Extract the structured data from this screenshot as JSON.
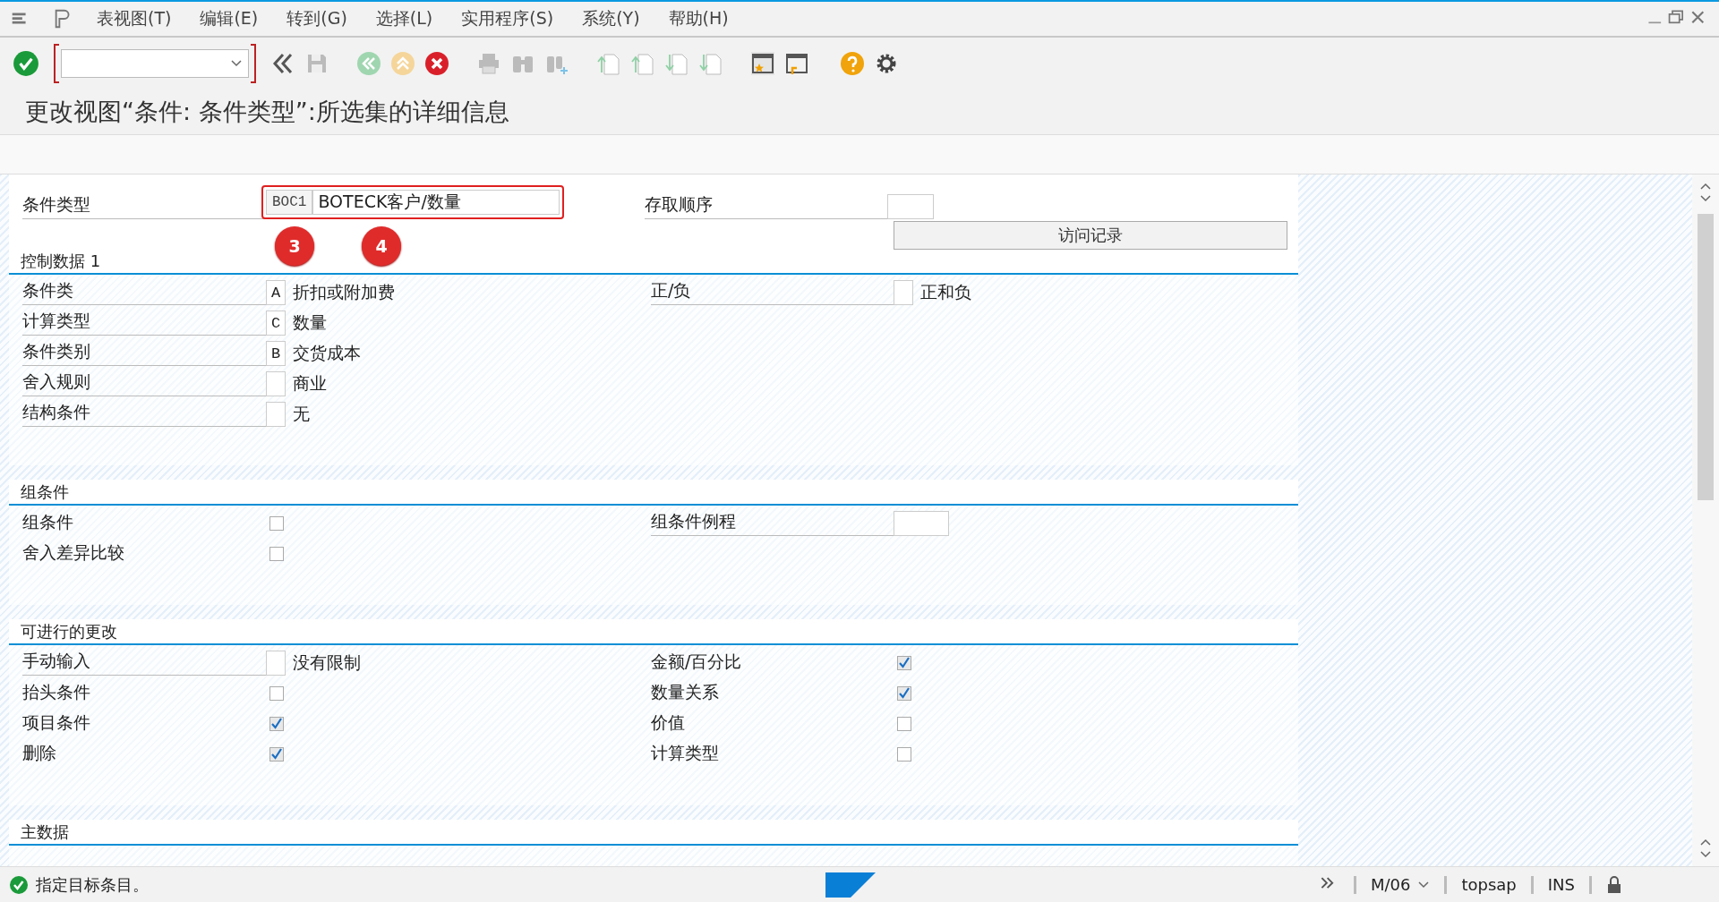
{
  "menu_bar": {
    "items": [
      "表视图(T)",
      "编辑(E)",
      "转到(G)",
      "选择(L)",
      "实用程序(S)",
      "系统(Y)",
      "帮助(H)"
    ]
  },
  "title": "更改视图“条件: 条件类型”:所选集的详细信息",
  "header": {
    "condition_type": {
      "label": "条件类型",
      "code": "BOC1",
      "value": "BOTECK客户/数量",
      "highlighted": true
    },
    "access_sequence": {
      "label": "存取顺序"
    },
    "access_button": "访问记录"
  },
  "annotations": [
    {
      "text": "3"
    },
    {
      "text": "4"
    }
  ],
  "sections": [
    {
      "title": "控制数据 1",
      "left": [
        {
          "kind": "field",
          "label": "条件类",
          "code": "A",
          "description": "折扣或附加费"
        },
        {
          "kind": "field",
          "label": "计算类型",
          "code": "C",
          "description": "数量"
        },
        {
          "kind": "field",
          "label": "条件类别",
          "code": "B",
          "description": "交货成本"
        },
        {
          "kind": "field",
          "label": "舍入规则",
          "description": "商业"
        },
        {
          "kind": "field",
          "label": "结构条件",
          "description": "无"
        }
      ],
      "right": [
        {
          "kind": "field",
          "label": "正/负",
          "description": "正和负"
        }
      ]
    },
    {
      "title": "组条件",
      "left": [
        {
          "kind": "checkbox",
          "label": "组条件",
          "checked": false
        },
        {
          "kind": "checkbox",
          "label": "舍入差异比较",
          "checked": false
        }
      ],
      "right": [
        {
          "kind": "wide_field",
          "label": "组条件例程"
        }
      ]
    },
    {
      "title": "可进行的更改",
      "left": [
        {
          "kind": "field",
          "label": "手动输入",
          "description": "没有限制"
        },
        {
          "kind": "checkbox",
          "label": "抬头条件",
          "checked": false
        },
        {
          "kind": "checkbox",
          "label": "项目条件",
          "checked": true
        },
        {
          "kind": "checkbox",
          "label": "删除",
          "checked": true
        }
      ],
      "right": [
        {
          "kind": "checkbox",
          "label": "金额/百分比",
          "checked": true
        },
        {
          "kind": "checkbox",
          "label": "数量关系",
          "checked": true
        },
        {
          "kind": "checkbox",
          "label": "价值",
          "checked": false
        },
        {
          "kind": "checkbox",
          "label": "计算类型",
          "checked": false
        }
      ]
    },
    {
      "title": "主数据"
    }
  ],
  "status_bar": {
    "message": "指定目标条目。",
    "client": "M/06",
    "server": "topsap",
    "mode": "INS"
  }
}
